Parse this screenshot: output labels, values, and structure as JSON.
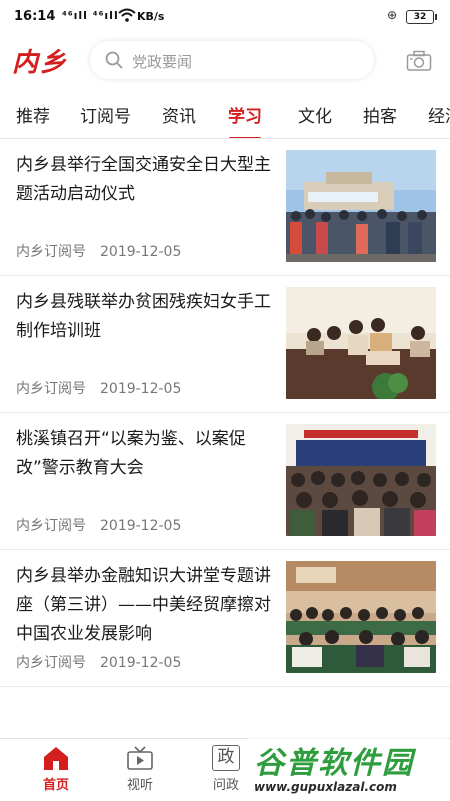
{
  "status_bar": {
    "time": "16:14",
    "signal": "⁴⁶ıll ⁴⁶ıll",
    "network": "KB/s",
    "battery": "32"
  },
  "header": {
    "logo_text": "内乡",
    "search_placeholder": "党政要闻",
    "brand_color": "#d51f1f"
  },
  "tabs": [
    {
      "label": "推荐",
      "active": false
    },
    {
      "label": "订阅号",
      "active": false
    },
    {
      "label": "资讯",
      "active": false
    },
    {
      "label": "学习",
      "active": true
    },
    {
      "label": "文化",
      "active": false
    },
    {
      "label": "拍客",
      "active": false
    },
    {
      "label": "经济",
      "active": false
    }
  ],
  "news": [
    {
      "title": "内乡县举行全国交通安全日大型主题活动启动仪式",
      "source": "内乡订阅号",
      "date": "2019-12-05"
    },
    {
      "title": "内乡县残联举办贫困残疾妇女手工制作培训班",
      "source": "内乡订阅号",
      "date": "2019-12-05"
    },
    {
      "title": "桃溪镇召开“以案为鉴、以案促改”警示教育大会",
      "source": "内乡订阅号",
      "date": "2019-12-05"
    },
    {
      "title": "内乡县举办金融知识大讲堂专题讲座（第三讲）——中美经贸摩擦对中国农业发展影响",
      "source": "内乡订阅号",
      "date": "2019-12-05"
    }
  ],
  "bottom_nav": [
    {
      "label": "首页",
      "icon": "home-icon",
      "active": true
    },
    {
      "label": "视听",
      "icon": "tv-icon",
      "active": false
    },
    {
      "label": "问政",
      "icon": "zheng-icon",
      "active": false
    }
  ],
  "watermark": {
    "text": "谷普软件园",
    "url": "www.gupuxlazal.com"
  }
}
